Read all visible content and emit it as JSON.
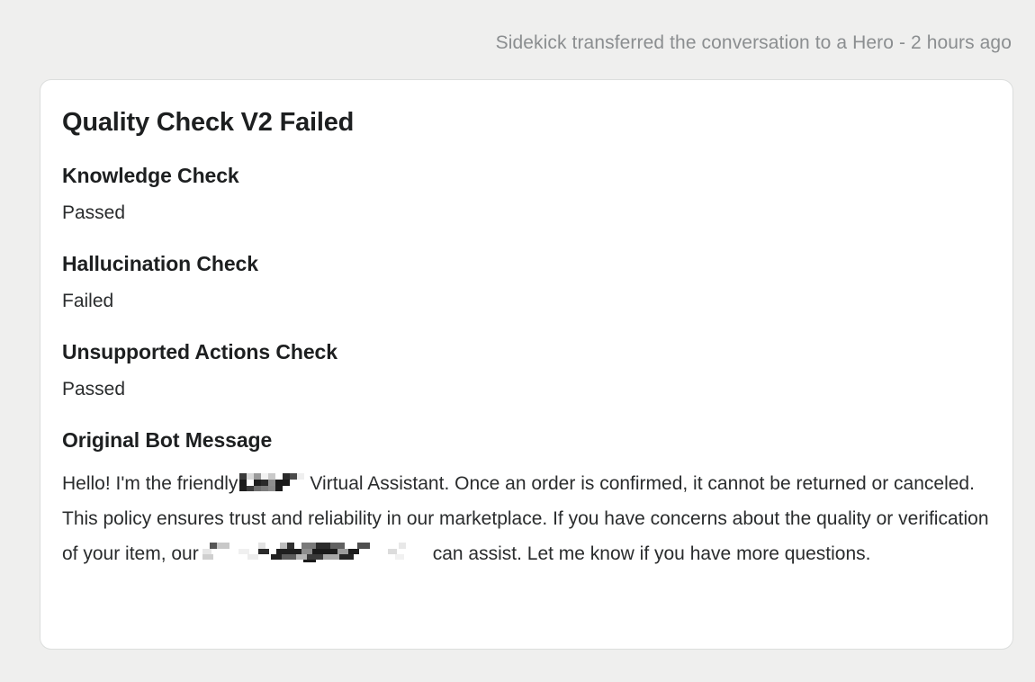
{
  "header": {
    "transfer_notice": "Sidekick transferred the conversation to a Hero - 2 hours ago"
  },
  "card": {
    "title": "Quality Check V2 Failed",
    "sections": [
      {
        "label": "Knowledge Check",
        "value": "Passed"
      },
      {
        "label": "Hallucination Check",
        "value": "Failed"
      },
      {
        "label": "Unsupported Actions Check",
        "value": "Passed"
      }
    ],
    "message": {
      "label": "Original Bot Message",
      "text_part_1": "Hello! I'm the friendly",
      "redacted_1": "[redacted]",
      "text_part_2": "Virtual Assistant. Once an order is confirmed, it cannot be returned or canceled. This policy ensures trust and reliability in our marketplace. If you have concerns about the quality or verification of your item, our",
      "redacted_2": "[redacted]",
      "text_part_3": "can assist. Let me know if you have more questions."
    }
  },
  "colors": {
    "page_background": "#efefee",
    "card_background": "#ffffff",
    "card_border": "#dcdedd",
    "title_text": "#1d1f20",
    "body_text": "#2a2c2d",
    "muted_text": "#8b8e90"
  }
}
